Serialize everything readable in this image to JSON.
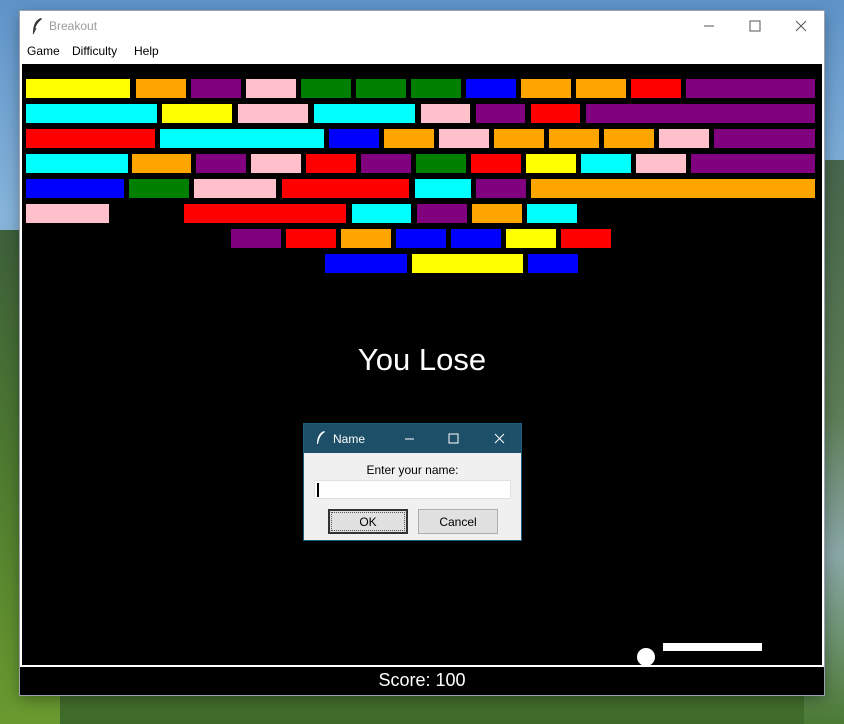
{
  "window": {
    "title": "Breakout"
  },
  "menu": [
    "Game",
    "Difficulty",
    "Help"
  ],
  "game": {
    "message": "You Lose",
    "score_text": "Score: 100",
    "colors": {
      "yellow": "#ffff00",
      "orange": "#ffa500",
      "purple": "#800080",
      "pink": "#ffc0cb",
      "green": "#008000",
      "blue": "#0000ff",
      "red": "#ff0000",
      "cyan": "#00ffff"
    },
    "brick_rows": [
      [
        "yellow",
        "orange",
        "purple",
        "pink",
        "green",
        "green",
        "green",
        "blue",
        "orange",
        "orange",
        "red",
        "purple"
      ],
      [
        "cyan",
        "yellow",
        "pink",
        "cyan",
        "pink",
        "purple",
        "red",
        "purple"
      ],
      [
        "red",
        "cyan",
        "blue",
        "orange",
        "pink",
        "orange",
        "orange",
        "orange",
        "pink",
        "purple"
      ],
      [
        "cyan",
        "orange",
        "purple",
        "pink",
        "red",
        "purple",
        "green",
        "red",
        "yellow",
        "cyan",
        "pink",
        "purple"
      ],
      [
        "blue",
        "green",
        "pink",
        "red",
        "cyan",
        "purple",
        "orange"
      ],
      [
        "pink",
        "red",
        "cyan",
        "purple",
        "orange",
        "cyan"
      ],
      [
        "purple",
        "red",
        "orange",
        "blue",
        "blue",
        "yellow",
        "red"
      ],
      [
        "blue",
        "yellow",
        "blue"
      ]
    ]
  },
  "dialog": {
    "title": "Name",
    "prompt": "Enter your name:",
    "input_value": "",
    "ok_label": "OK",
    "cancel_label": "Cancel"
  }
}
